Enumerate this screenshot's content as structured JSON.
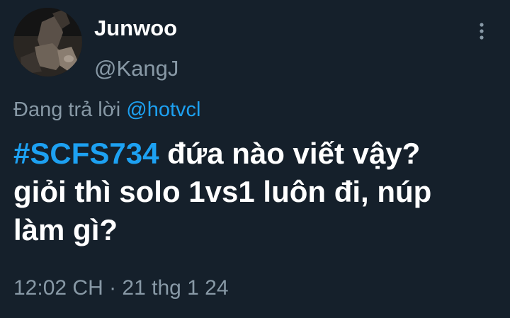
{
  "tweet": {
    "display_name": "Junwoo",
    "handle": "@KangJ",
    "more_icon": "more-vertical-icon",
    "reply_prefix": "Đang trả lời",
    "reply_mention": "@hotvcl",
    "hashtag": "#SCFS734",
    "body_line1_rest": "đứa nào viết vậy?",
    "body_line2": "giỏi thì solo 1vs1 luôn đi, núp",
    "body_line3": "làm gì?",
    "timestamp": "12:02 CH · 21 thg 1 24"
  },
  "colors": {
    "background": "#15202b",
    "primary_text": "#ffffff",
    "secondary_text": "#8899a6",
    "accent": "#1da1f2"
  }
}
